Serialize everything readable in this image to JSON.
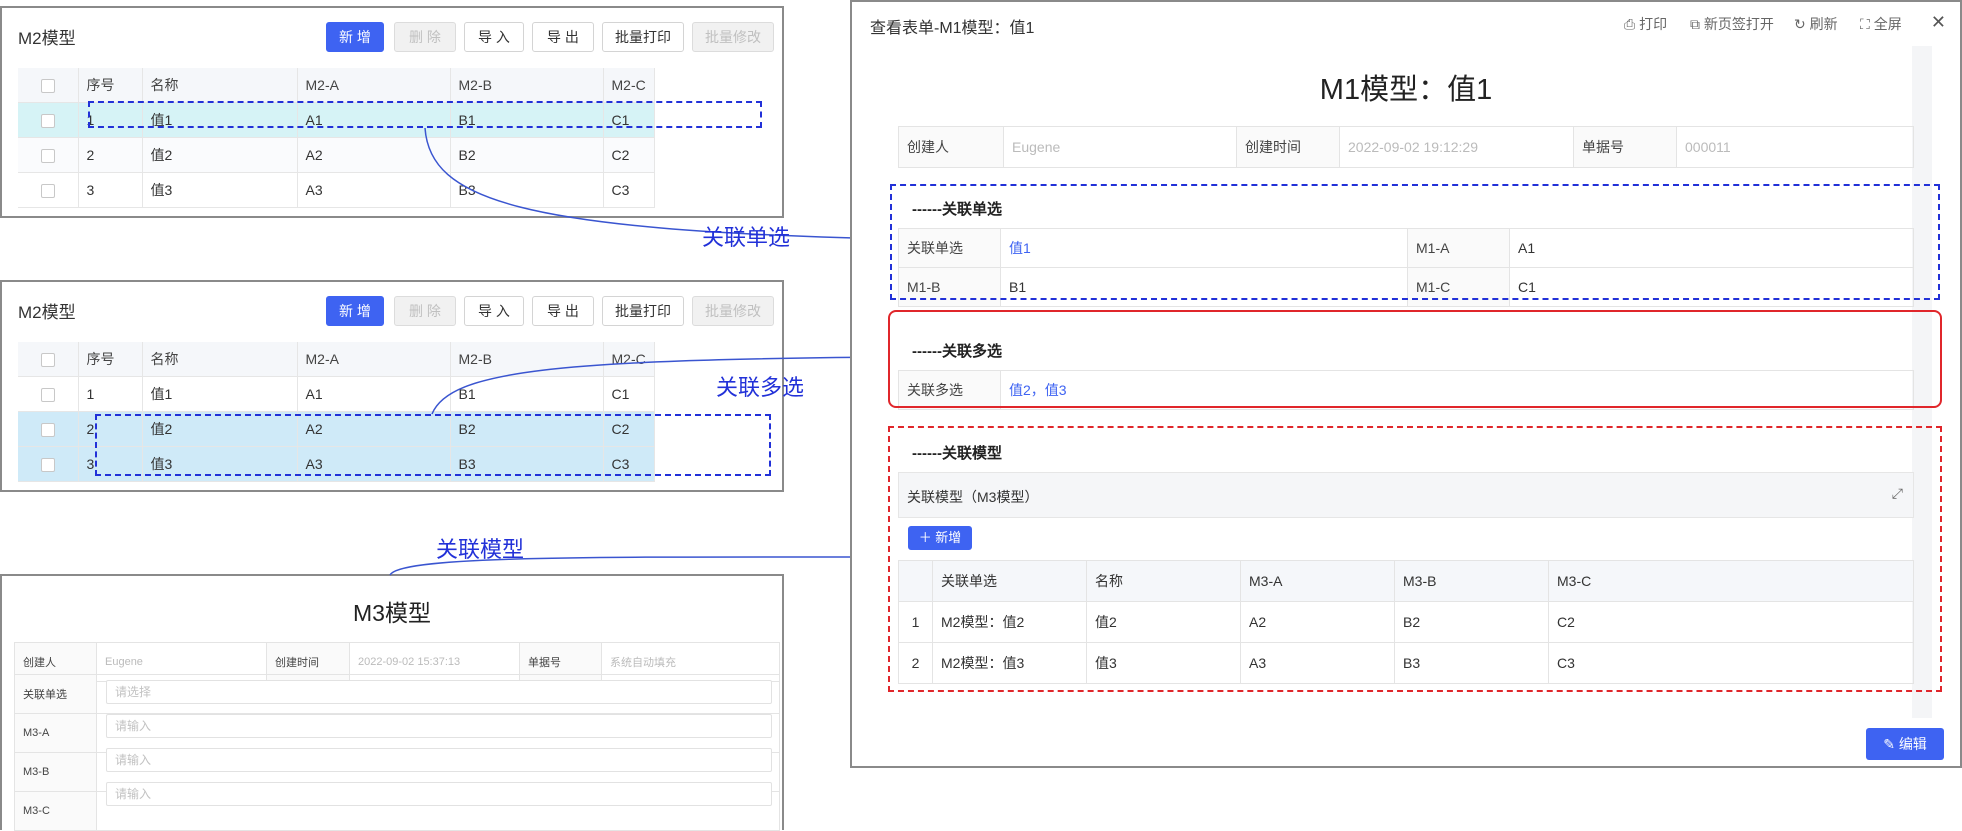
{
  "m2_panel": {
    "title": "M2模型",
    "buttons": {
      "add": "新 增",
      "delete": "删 除",
      "import": "导 入",
      "export": "导 出",
      "batch_print": "批量打印",
      "batch_edit": "批量修改"
    },
    "columns": [
      "序号",
      "名称",
      "M2-A",
      "M2-B",
      "M2-C"
    ],
    "rows": [
      {
        "no": "1",
        "name": "值1",
        "a": "A1",
        "b": "B1",
        "c": "C1"
      },
      {
        "no": "2",
        "name": "值2",
        "a": "A2",
        "b": "B2",
        "c": "C2"
      },
      {
        "no": "3",
        "name": "值3",
        "a": "A3",
        "b": "B3",
        "c": "C3"
      }
    ]
  },
  "annotations": {
    "single": "关联单选",
    "multi": "关联多选",
    "model": "关联模型"
  },
  "m3_panel": {
    "title": "M3模型",
    "creator_label": "创建人",
    "creator_value": "Eugene",
    "time_label": "创建时间",
    "time_value": "2022-09-02 15:37:13",
    "docno_label": "单据号",
    "docno_value": "系统自动填充",
    "fields": [
      {
        "label": "关联单选",
        "placeholder": "请选择"
      },
      {
        "label": "M3-A",
        "placeholder": "请输入"
      },
      {
        "label": "M3-B",
        "placeholder": "请输入"
      },
      {
        "label": "M3-C",
        "placeholder": "请输入"
      }
    ]
  },
  "modal": {
    "title": "查看表单-M1模型：值1",
    "tools": {
      "print": "打印",
      "new_tab": "新页签打开",
      "refresh": "刷新",
      "fullscreen": "全屏"
    },
    "close": "✕",
    "form_title": "M1模型：值1",
    "header": {
      "creator_label": "创建人",
      "creator_value": "Eugene",
      "time_label": "创建时间",
      "time_value": "2022-09-02 19:12:29",
      "docno_label": "单据号",
      "docno_value": "000011"
    },
    "single": {
      "heading": "------关联单选",
      "select_label": "关联单选",
      "select_value": "值1",
      "ma_label": "M1-A",
      "ma_value": "A1",
      "mb_label": "M1-B",
      "mb_value": "B1",
      "mc_label": "M1-C",
      "mc_value": "C1"
    },
    "multi": {
      "heading": "------关联多选",
      "label": "关联多选",
      "value": "值2，值3"
    },
    "model": {
      "heading": "------关联模型",
      "sub_title": "关联模型（M3模型）",
      "add_button": "＋ 新增",
      "columns": [
        "关联单选",
        "名称",
        "M3-A",
        "M3-B",
        "M3-C"
      ],
      "rows": [
        {
          "no": "1",
          "select": "M2模型：值2",
          "name": "值2",
          "a": "A2",
          "b": "B2",
          "c": "C2"
        },
        {
          "no": "2",
          "select": "M2模型：值3",
          "name": "值3",
          "a": "A3",
          "b": "B3",
          "c": "C3"
        }
      ]
    },
    "edit_button": "编辑"
  },
  "colors": {
    "primary": "#3e63f2",
    "annotation_blue": "#2231d8",
    "red": "#e0262b"
  }
}
